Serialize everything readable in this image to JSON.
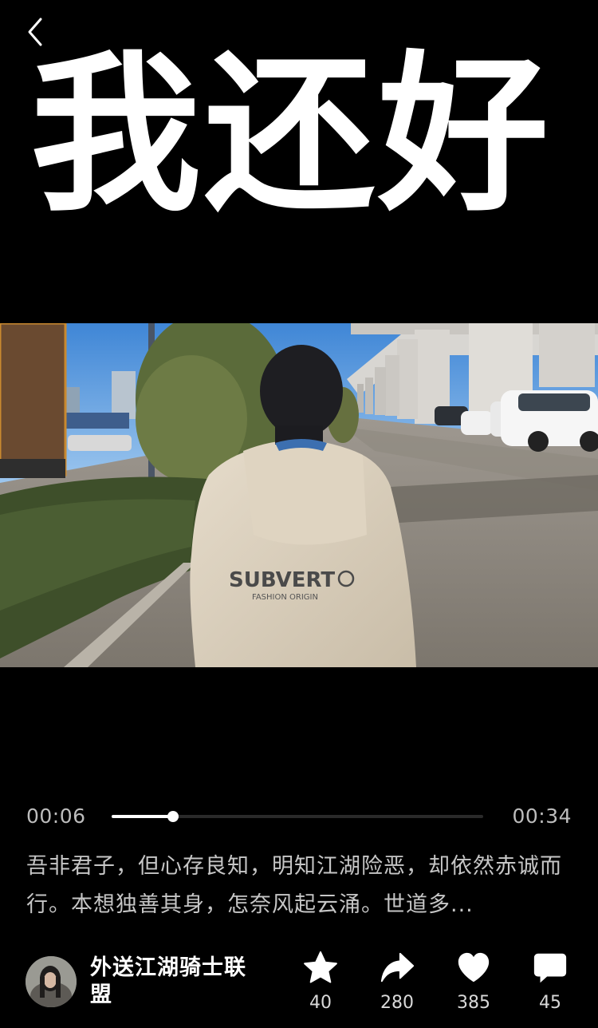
{
  "nav": {
    "back_icon": "chevron-left-icon"
  },
  "overlay_title": "我还好",
  "player": {
    "current_time": "00:06",
    "total_time": "00:34",
    "progress": 0.165
  },
  "video": {
    "jacket_brand": "SUBVERT",
    "jacket_sub": "FASHION ORIGIN"
  },
  "description": "吾非君子，但心存良知，明知江湖险恶，却依然赤诚而行。本想独善其身，怎奈风起云涌。世道多...",
  "author": {
    "name": "外送江湖骑士联盟"
  },
  "actions": [
    {
      "icon": "star-icon",
      "count": "40"
    },
    {
      "icon": "share-icon",
      "count": "280"
    },
    {
      "icon": "heart-icon",
      "count": "385"
    },
    {
      "icon": "comment-icon",
      "count": "45"
    }
  ],
  "colors": {
    "background": "#000000",
    "text": "#ffffff",
    "muted": "#c6c6c6"
  }
}
